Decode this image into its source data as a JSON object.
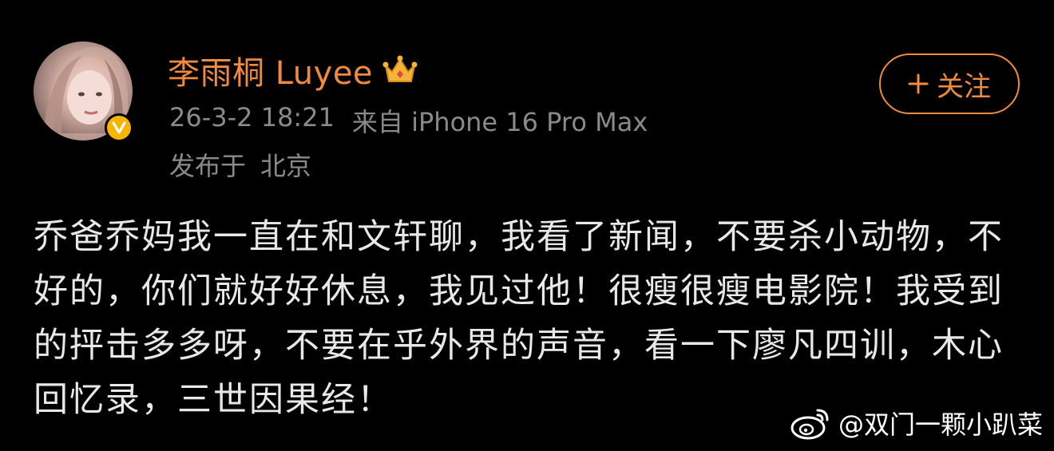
{
  "user": {
    "name": "李雨桐 Luyee",
    "avatar_icon": "profile-photo",
    "badge_icon": "verified-v-icon",
    "crown_icon": "member-crown-icon"
  },
  "post_meta": {
    "datetime": "26-3-2 18:21",
    "source": "来自 iPhone 16 Pro Max",
    "location_prefix": "发布于",
    "location": "北京"
  },
  "follow_button": {
    "label": "关注",
    "icon": "plus-icon"
  },
  "post": {
    "text": "乔爸乔妈我一直在和文轩聊，我看了新闻，不要杀小动物，不好的，你们就好好休息，我见过他！很瘦很瘦电影院！我受到的抨击多多呀，不要在乎外界的声音，看一下廖凡四训，木心回忆录，三世因果经！"
  },
  "watermark": {
    "text": "@双门一颗小趴菜",
    "icon": "weibo-logo-icon"
  },
  "colors": {
    "background": "#000000",
    "accent": "#f08a3c",
    "meta_text": "#8a8a8a",
    "body_text": "#e8e8e8",
    "verified": "#f7b500"
  }
}
